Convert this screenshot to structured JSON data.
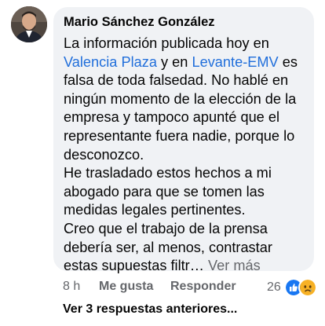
{
  "comment": {
    "author": "Mario Sánchez González",
    "text_intro": "La información publicada hoy en",
    "link1": "Valencia Plaza",
    "text_and": "y en",
    "link2": "Levante-EMV",
    "text_es": "es",
    "text_line3": "falsa de toda falsedad. No hablé en",
    "text_line4": "ningún momento de la elección de la",
    "text_line5": "empresa y tampoco apunté que el",
    "text_line6": "representante fuera nadie, porque lo",
    "text_line7": "desconozco.",
    "para2_line1": "He trasladado estos hechos a mi",
    "para2_line2": "abogado para que se tomen las",
    "para2_line3": "medidas legales pertinentes.",
    "para3_line1": "Creo que el trabajo de la prensa",
    "para3_line2": "debería ser, al menos, contrastar",
    "para3_line3": "estas supuestas filtr…",
    "see_more": "Ver más"
  },
  "actions": {
    "time": "8 h",
    "like": "Me gusta",
    "reply": "Responder",
    "reaction_count": "26",
    "reaction_icons": [
      "like-icon",
      "sad-icon"
    ]
  },
  "replies": {
    "label": "Ver 3 respuestas anteriores..."
  },
  "colors": {
    "bubble": "#f0f2f5",
    "link": "#216fdb",
    "muted": "#65676b",
    "like_blue": "#1877f2",
    "sad_yellow": "#f7b125"
  }
}
